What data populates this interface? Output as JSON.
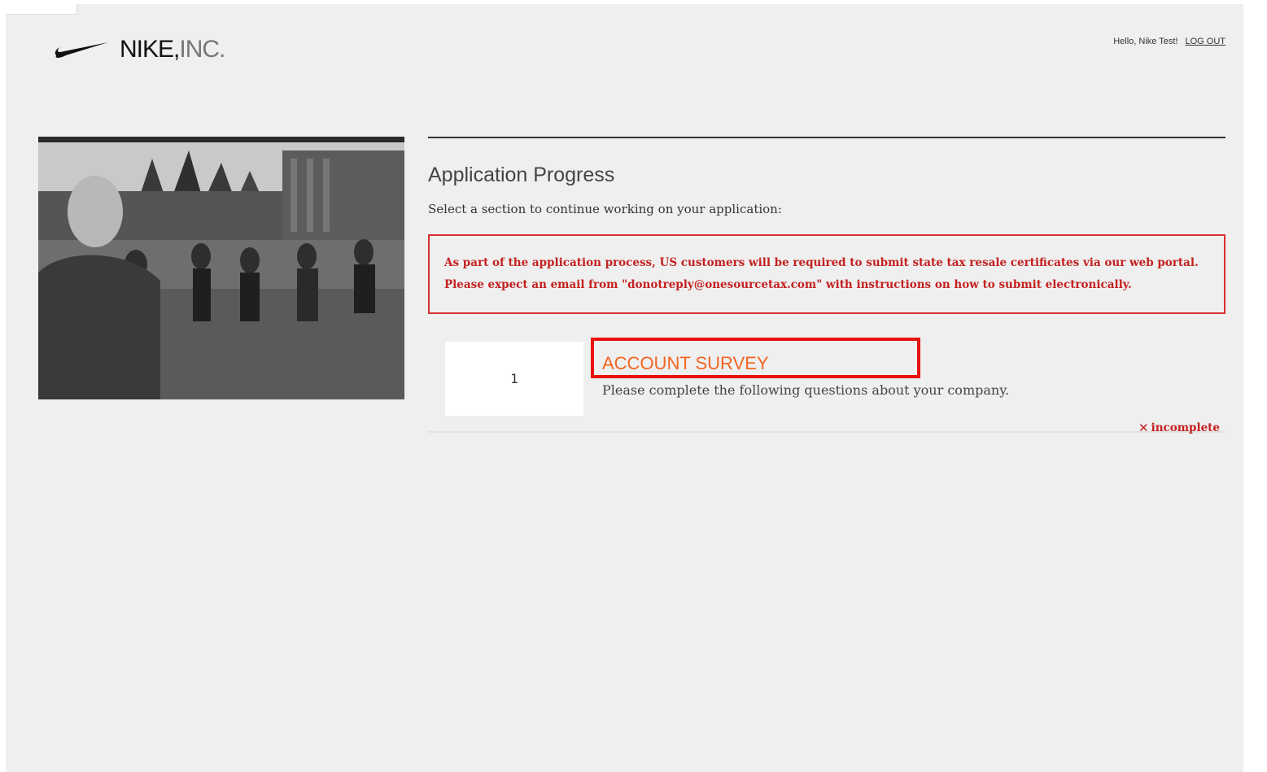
{
  "header": {
    "logo_name": "NIKE,",
    "logo_suffix": "INC.",
    "greeting": "Hello, Nike Test!",
    "logout_label": "LOG OUT"
  },
  "hero": {
    "icon": "photo-image"
  },
  "main": {
    "title": "Application Progress",
    "subtitle": "Select a section to continue working on your application:",
    "notice": "As part of the application process, US customers will be required to submit state tax resale certificates via our web portal. Please expect an email from \"donotreply@onesourcetax.com\" with instructions on how to submit electronically.",
    "sections": [
      {
        "number": "1",
        "title": "ACCOUNT SURVEY",
        "description": "Please complete the following questions about your company.",
        "status_icon": "✕",
        "status": "incomplete"
      }
    ]
  },
  "colors": {
    "accent": "#f26522",
    "alert": "#c42020",
    "highlight_box": "#e81010",
    "background": "#efefef"
  }
}
